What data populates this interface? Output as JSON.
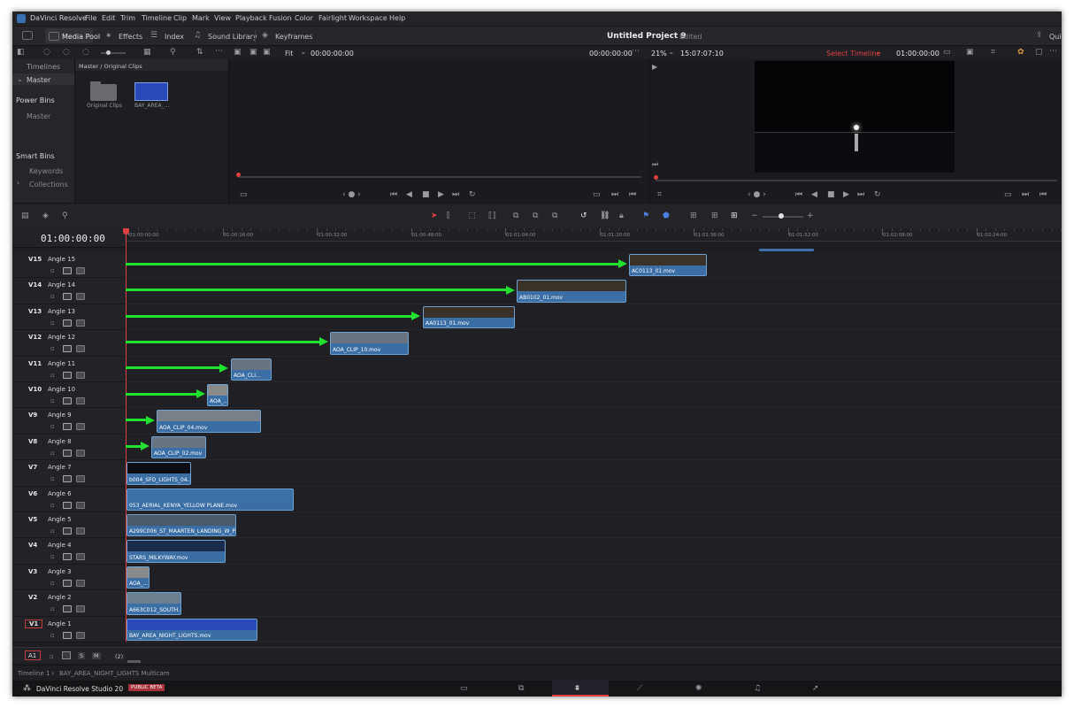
{
  "menu": {
    "app": "DaVinci Resolve",
    "items": [
      "File",
      "Edit",
      "Trim",
      "Timeline",
      "Clip",
      "Mark",
      "View",
      "Playback",
      "Fusion",
      "Color",
      "Fairlight",
      "Workspace",
      "Help"
    ]
  },
  "toolbar": {
    "media_pool": "Media Pool",
    "effects": "Effects",
    "index": "Index",
    "sound_library": "Sound Library",
    "keyframes": "Keyframes",
    "project_title": "Untitled Project 9",
    "edited": "Edited",
    "quick_export": "Qui"
  },
  "viewer": {
    "fit": "Fit",
    "src_tc": "00:00:00:00",
    "src_tc_right": "00:00:00:00",
    "zoom": "21%",
    "duration_tc": "15:07:07:10",
    "select_timeline": "Select Timeline",
    "rec_tc": "01:00:00:00"
  },
  "sidebar": {
    "timelines": "Timelines",
    "master": "Master",
    "power_bins": "Power Bins",
    "power_master": "Master",
    "smart_bins": "Smart Bins",
    "keywords": "Keywords",
    "collections": "Collections"
  },
  "media": {
    "breadcrumb": "Master / Original Clips",
    "folder_label": "Original Clips",
    "clip_label": "BAY_AREA_..."
  },
  "timeline": {
    "timecode": "01:00:00:00",
    "ruler": [
      "01:00:00:00",
      "01:00:16:00",
      "01:00:32:00",
      "01:00:48:00",
      "01:01:04:00",
      "01:01:20:00",
      "01:01:36:00",
      "01:01:52:00",
      "01:02:08:00",
      "01:02:24:00"
    ],
    "tracks": [
      {
        "id": "V15",
        "name": "Angle 15"
      },
      {
        "id": "V14",
        "name": "Angle 14"
      },
      {
        "id": "V13",
        "name": "Angle 13"
      },
      {
        "id": "V12",
        "name": "Angle 12"
      },
      {
        "id": "V11",
        "name": "Angle 11"
      },
      {
        "id": "V10",
        "name": "Angle 10"
      },
      {
        "id": "V9",
        "name": "Angle 9"
      },
      {
        "id": "V8",
        "name": "Angle 8"
      },
      {
        "id": "V7",
        "name": "Angle 7"
      },
      {
        "id": "V6",
        "name": "Angle 6"
      },
      {
        "id": "V5",
        "name": "Angle 5"
      },
      {
        "id": "V4",
        "name": "Angle 4"
      },
      {
        "id": "V3",
        "name": "Angle 3"
      },
      {
        "id": "V2",
        "name": "Angle 2"
      },
      {
        "id": "V1",
        "name": "Angle 1"
      }
    ],
    "clips": [
      {
        "name": "AC0113_01.mov"
      },
      {
        "name": "AB0102_01.mov"
      },
      {
        "name": "AA0113_01.mov"
      },
      {
        "name": "AOA_CLIP_10.mov"
      },
      {
        "name": "AOA_CLI..."
      },
      {
        "name": "AOA_..."
      },
      {
        "name": "AOA_CLIP_04.mov"
      },
      {
        "name": "AOA_CLIP_02.mov"
      },
      {
        "name": "b004_SFO_LIGHTS_04..."
      },
      {
        "name": "053_AERIAL_KENYA_YELLOW PLANE.mov"
      },
      {
        "name": "A299C006_ST_MAARTEN_LANDING_W_P..."
      },
      {
        "name": "STARS_MILKYWAY.mov"
      },
      {
        "name": "AOA_..."
      },
      {
        "name": "A663C012_SOUTH..."
      },
      {
        "name": "BAY_AREA_NIGHT_LIGHTS.mov"
      }
    ],
    "audio_track": "A1",
    "audio_s": "S",
    "audio_m": "M",
    "audio_count": "(2)"
  },
  "status": {
    "breadcrumb_timeline": "Timeline 1",
    "breadcrumb_clip": "BAY_AREA_NIGHT_LIGHTS Multicam",
    "product": "DaVinci Resolve Studio 20",
    "badge": "PUBLIC BETA"
  },
  "colors": {
    "accent_red": "#e04040",
    "clip_blue": "#3a6ea4",
    "arrow_green": "#22e12f"
  }
}
